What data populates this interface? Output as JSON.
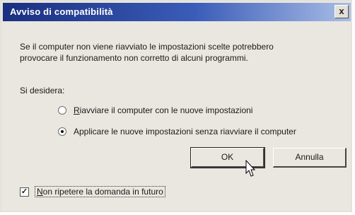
{
  "window": {
    "title": "Avviso di compatibilità",
    "close_glyph": "x"
  },
  "message": {
    "line1": "Se il computer non viene riavviato le impostazioni scelte potrebbero",
    "line2": "provocare il funzionamento non corretto di alcuni programmi."
  },
  "question": "Si desidera:",
  "options": [
    {
      "mnemonic": "R",
      "rest": "iavviare il computer con le nuove impostazioni",
      "selected": false
    },
    {
      "label": "Applicare le nuove impostazioni senza riavviare il computer",
      "selected": true
    }
  ],
  "buttons": {
    "ok": "OK",
    "cancel": "Annulla"
  },
  "checkbox": {
    "mnemonic": "N",
    "rest": "on ripetere la domanda in futuro",
    "checked": true,
    "check_glyph": "✓"
  },
  "colors": {
    "titlebar_start": "#1a2f80",
    "titlebar_end": "#a9bde6",
    "dialog_bg": "#e9e7df"
  },
  "icons": [
    "close-icon",
    "radio-icon",
    "checkbox-icon",
    "mouse-pointer-icon"
  ]
}
